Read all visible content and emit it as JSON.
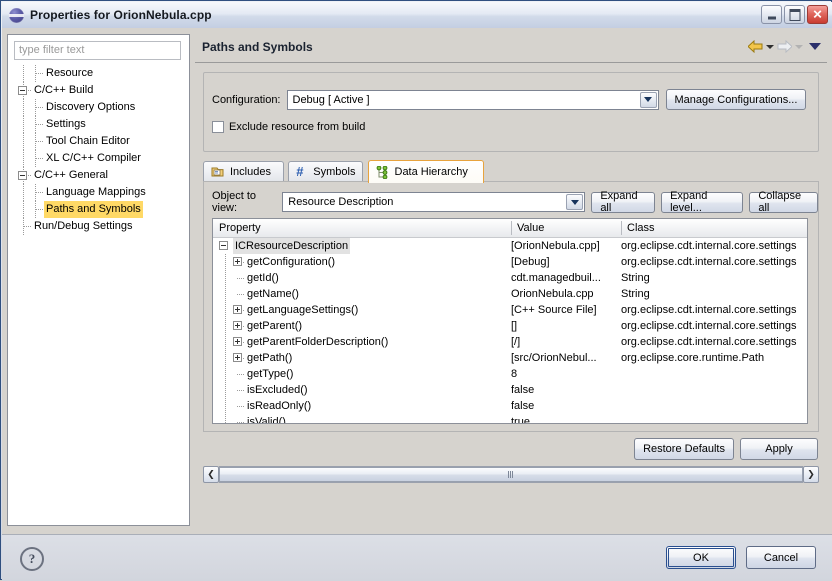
{
  "window": {
    "title": "Properties for OrionNebula.cpp",
    "icon": "eclipse-sphere-icon",
    "buttons": {
      "minimize": "–",
      "maximize": "▢",
      "close": "✕"
    }
  },
  "sidebar": {
    "filter_placeholder": "type filter text",
    "items": [
      {
        "label": "Resource",
        "depth": 1,
        "expander": null,
        "selected": false
      },
      {
        "label": "C/C++ Build",
        "depth": 0,
        "expander": "minus",
        "selected": false
      },
      {
        "label": "Discovery Options",
        "depth": 1,
        "expander": null,
        "selected": false
      },
      {
        "label": "Settings",
        "depth": 1,
        "expander": null,
        "selected": false
      },
      {
        "label": "Tool Chain Editor",
        "depth": 1,
        "expander": null,
        "selected": false
      },
      {
        "label": "XL C/C++ Compiler",
        "depth": 1,
        "expander": null,
        "selected": false
      },
      {
        "label": "C/C++ General",
        "depth": 0,
        "expander": "minus",
        "selected": false
      },
      {
        "label": "Language Mappings",
        "depth": 1,
        "expander": null,
        "selected": false
      },
      {
        "label": "Paths and Symbols",
        "depth": 1,
        "expander": null,
        "selected": true
      },
      {
        "label": "Run/Debug Settings",
        "depth": 0,
        "expander": null,
        "selected": false
      }
    ]
  },
  "page": {
    "title": "Paths and Symbols",
    "nav": {
      "back_icon": "back-arrow-icon",
      "back_menu_icon": "caret-down-icon",
      "forward_icon": "forward-arrow-icon",
      "forward_menu_icon": "caret-down-icon",
      "menu_icon": "view-menu-caret-icon"
    }
  },
  "configuration": {
    "label": "Configuration:",
    "value": "Debug  [ Active ]",
    "dropdown_icon": "chevron-down-icon",
    "manage_label": "Manage Configurations...",
    "exclude_label": "Exclude resource from build",
    "exclude_checked": false
  },
  "tabs": [
    {
      "label": "Includes",
      "icon": "includes-folder-icon",
      "active": false
    },
    {
      "label": "Symbols",
      "icon": "hash-symbols-icon",
      "active": false
    },
    {
      "label": "Data Hierarchy",
      "icon": "data-hierarchy-icon",
      "active": true
    }
  ],
  "object_to_view": {
    "label": "Object to view:",
    "value": "Resource Description",
    "dropdown_icon": "chevron-down-icon",
    "expand_all": "Expand all",
    "expand_level": "Expand level...",
    "collapse_all": "Collapse all"
  },
  "table": {
    "columns": [
      "Property",
      "Value",
      "Class"
    ],
    "rows": [
      {
        "property": "ICResourceDescription",
        "value": "[OrionNebula.cpp]",
        "class": "org.eclipse.cdt.internal.core.settings",
        "depth": 0,
        "expander": "minus",
        "selected": true
      },
      {
        "property": "getConfiguration()",
        "value": "[Debug]",
        "class": "org.eclipse.cdt.internal.core.settings",
        "depth": 1,
        "expander": "plus",
        "selected": false
      },
      {
        "property": "getId()",
        "value": "cdt.managedbuil...",
        "class": "String",
        "depth": 1,
        "expander": null,
        "selected": false
      },
      {
        "property": "getName()",
        "value": "OrionNebula.cpp",
        "class": "String",
        "depth": 1,
        "expander": null,
        "selected": false
      },
      {
        "property": "getLanguageSettings()",
        "value": "[C++ Source File]",
        "class": "org.eclipse.cdt.internal.core.settings",
        "depth": 1,
        "expander": "plus",
        "selected": false
      },
      {
        "property": "getParent()",
        "value": "[]",
        "class": "org.eclipse.cdt.internal.core.settings",
        "depth": 1,
        "expander": "plus",
        "selected": false
      },
      {
        "property": "getParentFolderDescription()",
        "value": "[/]",
        "class": "org.eclipse.cdt.internal.core.settings",
        "depth": 1,
        "expander": "plus",
        "selected": false
      },
      {
        "property": "getPath()",
        "value": "[src/OrionNebul...",
        "class": "org.eclipse.core.runtime.Path",
        "depth": 1,
        "expander": "plus",
        "selected": false
      },
      {
        "property": "getType()",
        "value": "8",
        "class": "",
        "depth": 1,
        "expander": null,
        "selected": false
      },
      {
        "property": "isExcluded()",
        "value": "false",
        "class": "",
        "depth": 1,
        "expander": null,
        "selected": false
      },
      {
        "property": "isReadOnly()",
        "value": "false",
        "class": "",
        "depth": 1,
        "expander": null,
        "selected": false
      },
      {
        "property": "isValid()",
        "value": "true",
        "class": "",
        "depth": 1,
        "expander": null,
        "selected": false
      }
    ]
  },
  "page_actions": {
    "restore_defaults": "Restore Defaults",
    "apply": "Apply"
  },
  "scrollbar": {
    "left_icon": "scroll-left-icon",
    "right_icon": "scroll-right-icon",
    "left_glyph": "❮",
    "right_glyph": "❯"
  },
  "footer": {
    "help_icon": "help-question-icon",
    "help_glyph": "?",
    "ok": "OK",
    "cancel": "Cancel"
  },
  "colors": {
    "selection_highlight": "#ffd966",
    "active_tab_border": "#e8a33d",
    "row_selection": "#e2e2e2",
    "window_border": "#2f4f7f",
    "dialog_bg": "#d6d3ce"
  }
}
